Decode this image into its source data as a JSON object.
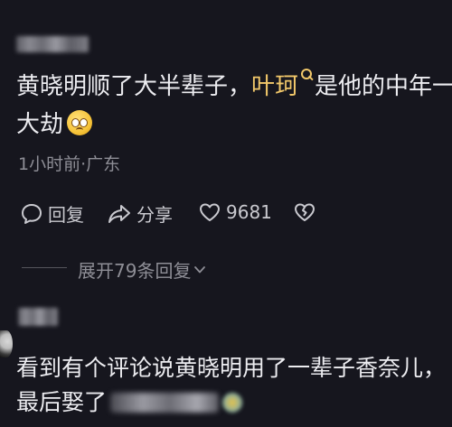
{
  "comment1": {
    "text_before": "黄晓明顺了大半辈子，",
    "mention": "叶珂",
    "mention_icon": "search-icon",
    "text_after": "是他的中年一",
    "line2": "大劫",
    "emoji": "anxious-face-emoji",
    "meta": "1小时前·广东",
    "actions": {
      "reply_label": "回复",
      "share_label": "分享",
      "like_count": "9681"
    },
    "expand_label": "展开79条回复"
  },
  "comment2": {
    "line1": "看到有个评论说黄晓明用了一辈子香奈儿，",
    "line2_visible": "最后娶了"
  },
  "colors": {
    "background": "#16161e",
    "text": "#ececf0",
    "mention": "#f2c86a",
    "meta": "#8e8e96"
  }
}
